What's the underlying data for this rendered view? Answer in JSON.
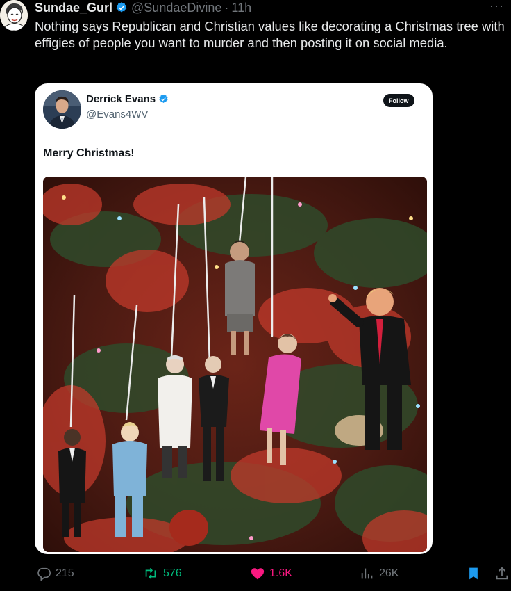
{
  "tweet": {
    "display_name": "Sundae_Gurl",
    "handle": "@SundaeDivine",
    "separator": "·",
    "time": "11h",
    "more_label": "···",
    "text": "Nothing says Republican and Christian values like decorating a Christmas tree with effigies of people you want to murder and then posting it on social media."
  },
  "quoted": {
    "display_name": "Derrick Evans",
    "handle": "@Evans4WV",
    "follow_label": "Follow",
    "more_label": "···",
    "text": "Merry Christmas!"
  },
  "actions": {
    "replies": "215",
    "reposts": "576",
    "likes": "1.6K",
    "views": "26K"
  },
  "colors": {
    "background": "#000000",
    "verified": "#1d9bf0",
    "repost_green": "#00ba7c",
    "like_pink": "#f91880",
    "bookmark_blue": "#1d9bf0"
  }
}
